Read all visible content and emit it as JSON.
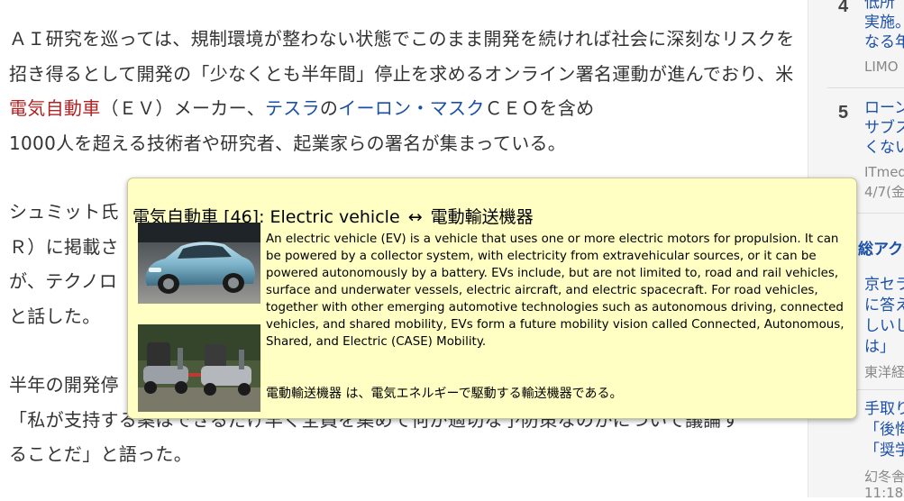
{
  "article": {
    "p1_a": "ＡＩ研究を巡っては、規制環境が整わない状態でこのまま開発を続ければ社会に深刻なリスクを招き得るとして開発の「少なくとも半年間」停止を求めるオンライン署名運動が進んでおり、米",
    "p1_link_ev": "電気自動車",
    "p1_b": "（ＥＶ）メーカー、",
    "p1_link_tesla": "テスラ",
    "p1_c": "の",
    "p1_link_musk": "イーロン・マスク",
    "p1_d": "ＣＥＯを含め",
    "p1_e": "1000人を超える技術者や研究者、起業家らの署名が集まっている。",
    "p2_line1": "シュミット氏",
    "p2_line2": "Ｒ）に掲載さ",
    "p2_line3": "が、テクノロ",
    "p2_line4": "と話した。",
    "p3_line1": "半年の開発停",
    "p3_line2": "「私が支持する案はできるだけ早く全員を集めて何が適切な予防策なのかについて議論す",
    "p3_line3": "ることだ」と語った。"
  },
  "sidebar": {
    "item4": {
      "rank": "4",
      "line1": "低所",
      "line2": "実施。",
      "line3": "なる年",
      "source": "LIMO"
    },
    "item5": {
      "rank": "5",
      "line1": "ローン",
      "line2": "サブス",
      "line3": "くない",
      "source": "ITmed",
      "date": "4/7(金"
    },
    "section_heading": "総アクセ",
    "item_a": {
      "line1": "京セラ",
      "line2": "に答え",
      "line3": "しいし",
      "line4": "は」",
      "source": "東洋経"
    },
    "item_b": {
      "line1": "手取り",
      "line2": "「後悔",
      "line3": "「奨学",
      "source": "幻冬舎",
      "date": "11:18"
    }
  },
  "popup": {
    "term": "電気自動車",
    "count": "[46]:",
    "english_term": "Electric vehicle",
    "arrow": "↔",
    "japanese_term": "電動輸送機器",
    "english_description": "An electric vehicle (EV) is a vehicle that uses one or more electric motors for propulsion. It can be powered by a collector system, with electricity from extravehicular sources, or it can be powered autonomously by a battery. EVs include, but are not limited to, road and rail vehicles, surface and underwater vessels, electric aircraft, and electric spacecraft. For road vehicles, together with other emerging automotive technologies such as autonomous driving, connected vehicles, and shared mobility, EVs form a future mobility vision called Connected, Autonomous, Shared, and Electric (CASE) Mobility.",
    "japanese_description": "電動輸送機器 は、電気エネルギーで駆動する輸送機器である。",
    "image1_desc": "blue electric car photo",
    "image2_desc": "mobility scooters photo"
  },
  "colors": {
    "popup_bg": "#ffffc4",
    "link_red": "#b22222",
    "link_blue": "#1a4fa8"
  }
}
